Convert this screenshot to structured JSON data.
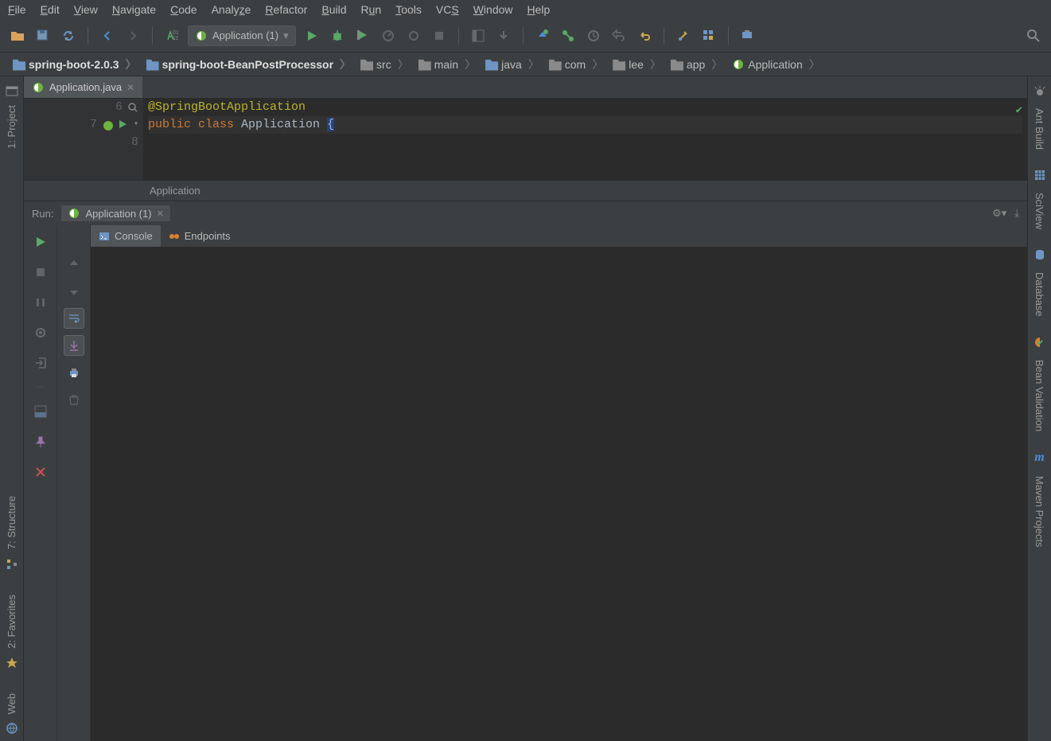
{
  "menu": {
    "file": "File",
    "edit": "Edit",
    "view": "View",
    "navigate": "Navigate",
    "code": "Code",
    "analyze": "Analyze",
    "refactor": "Refactor",
    "build": "Build",
    "run": "Run",
    "tools": "Tools",
    "vcs": "VCS",
    "window": "Window",
    "help": "Help"
  },
  "runConfig": {
    "label": "Application (1)"
  },
  "breadcrumbs": [
    {
      "label": "spring-boot-2.0.3",
      "icon": "folder",
      "bold": true
    },
    {
      "label": "spring-boot-BeanPostProcessor",
      "icon": "folder",
      "bold": true
    },
    {
      "label": "src",
      "icon": "folder-dk"
    },
    {
      "label": "main",
      "icon": "folder-dk"
    },
    {
      "label": "java",
      "icon": "folder"
    },
    {
      "label": "com",
      "icon": "folder-dk"
    },
    {
      "label": "lee",
      "icon": "folder-dk"
    },
    {
      "label": "app",
      "icon": "folder-dk"
    },
    {
      "label": "Application",
      "icon": "spring"
    }
  ],
  "editorTab": {
    "label": "Application.java"
  },
  "code": {
    "lines": [
      {
        "num": "6",
        "html": "@SpringBootApplication",
        "type": "ann",
        "gutterIcon": "search"
      },
      {
        "num": "7",
        "html": "public class Application {",
        "type": "mix",
        "gutterIcon": "run",
        "hl": true
      },
      {
        "num": "8",
        "html": "",
        "type": "plain"
      }
    ]
  },
  "editorStatus": "Application",
  "run": {
    "title": "Run:",
    "tab": "Application (1)",
    "consoleTab": "Console",
    "endpointsTab": "Endpoints"
  },
  "leftTabs": {
    "project": "1: Project",
    "structure": "7: Structure",
    "favorites": "2: Favorites",
    "web": "Web"
  },
  "rightTabs": {
    "ant": "Ant Build",
    "sci": "SciView",
    "db": "Database",
    "bean": "Bean Validation",
    "maven": "Maven Projects"
  }
}
